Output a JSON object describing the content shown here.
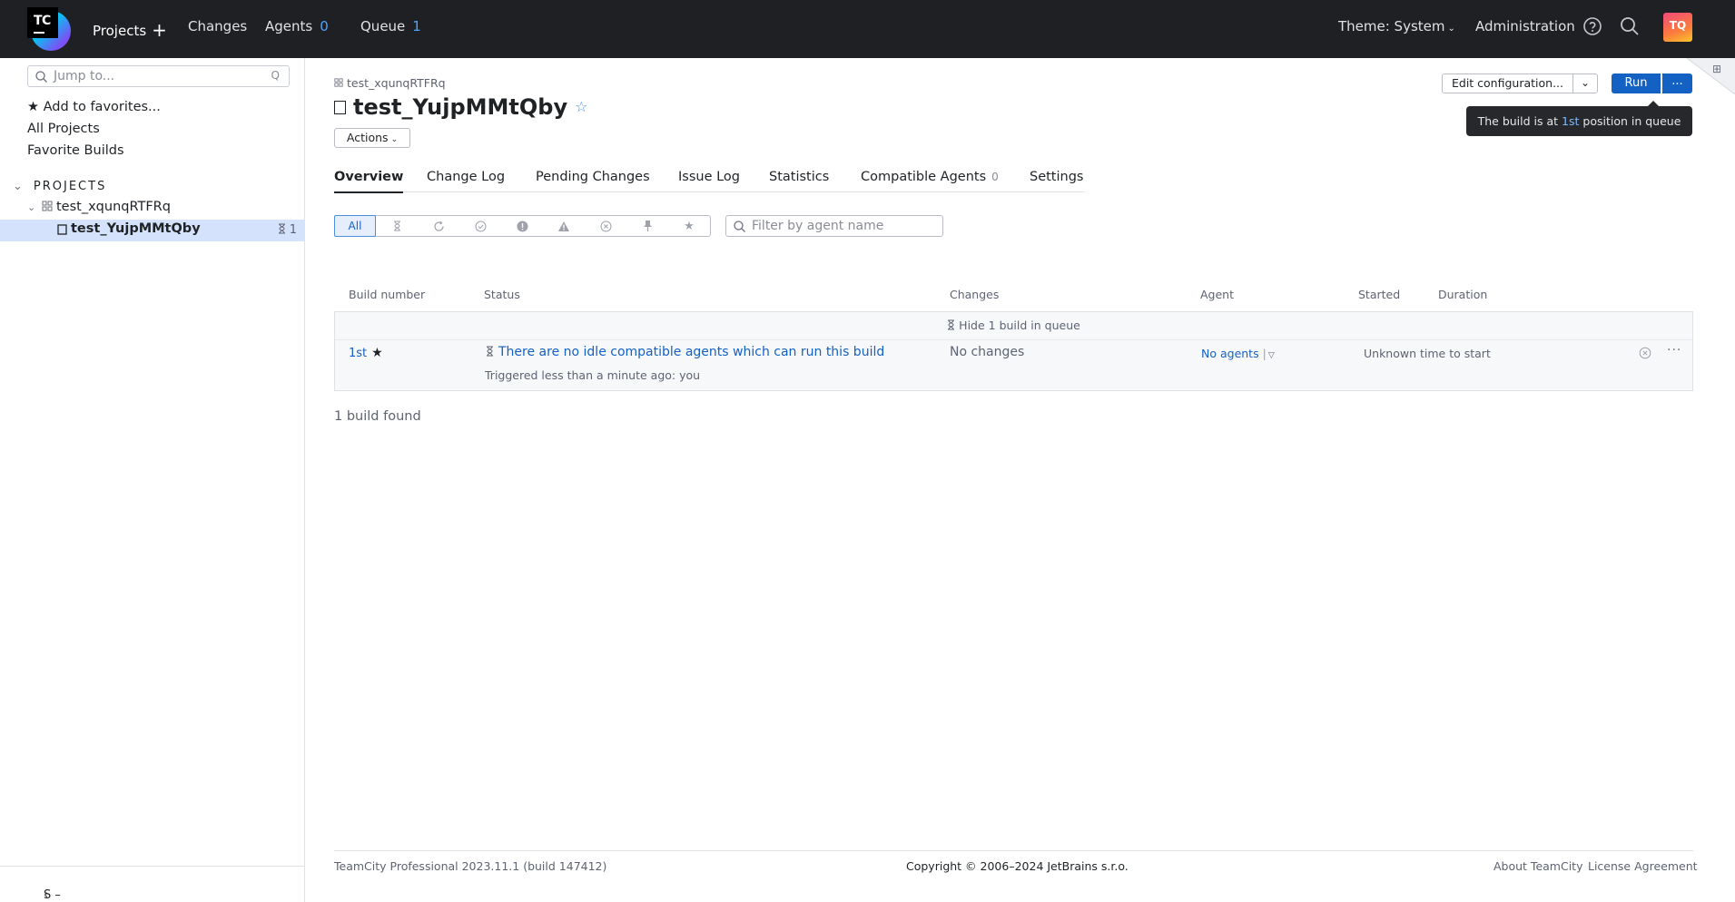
{
  "header": {
    "logo_text": "TC",
    "nav": {
      "projects": "Projects",
      "changes": "Changes",
      "agents": "Agents",
      "agents_count": "0",
      "queue": "Queue",
      "queue_count": "1"
    },
    "theme": "Theme: System",
    "administration": "Administration",
    "avatar_initials": "TQ"
  },
  "sidebar": {
    "search_placeholder": "Jump to...",
    "search_shortcut": "Q",
    "add_favorites": "★ Add to favorites...",
    "all_projects": "All Projects",
    "favorite_builds": "Favorite Builds",
    "projects_heading": "PROJECTS",
    "tree": {
      "project": "test_xqunqRTFRq",
      "build_config": "test_YujpMMtQby",
      "queue_count": "1"
    },
    "hide_sidebar": "S – hide sidebar"
  },
  "main": {
    "breadcrumb": "test_xqunqRTFRq",
    "title": "test_YujpMMtQby",
    "actions_label": "Actions",
    "edit_configuration": "Edit configuration...",
    "run_label": "Run",
    "run_more": "...",
    "tooltip_pre": "The build is at ",
    "tooltip_pos": "1st",
    "tooltip_post": " position in queue",
    "tabs": [
      {
        "label": "Overview"
      },
      {
        "label": "Change Log"
      },
      {
        "label": "Pending Changes"
      },
      {
        "label": "Issue Log"
      },
      {
        "label": "Statistics"
      },
      {
        "label": "Compatible Agents",
        "count": "0"
      },
      {
        "label": "Settings"
      }
    ],
    "filter_all": "All",
    "agent_filter_placeholder": "Filter by agent name",
    "columns": {
      "build_number": "Build number",
      "status": "Status",
      "changes": "Changes",
      "agent": "Agent",
      "started": "Started",
      "duration": "Duration"
    },
    "queue_toggle": "Hide 1 build in queue",
    "row": {
      "number": "1st",
      "status": "There are no idle compatible agents which can run this build",
      "triggered": "Triggered less than a minute ago: you",
      "changes": "No changes",
      "agent": "No agents",
      "started": "Unknown time to start"
    },
    "found": "1 build found"
  },
  "footer": {
    "version": "TeamCity Professional 2023.11.1 (build 147412)",
    "copyright": "Copyright © 2006–2024 JetBrains s.r.o.",
    "about": "About TeamCity",
    "license": "License Agreement"
  }
}
